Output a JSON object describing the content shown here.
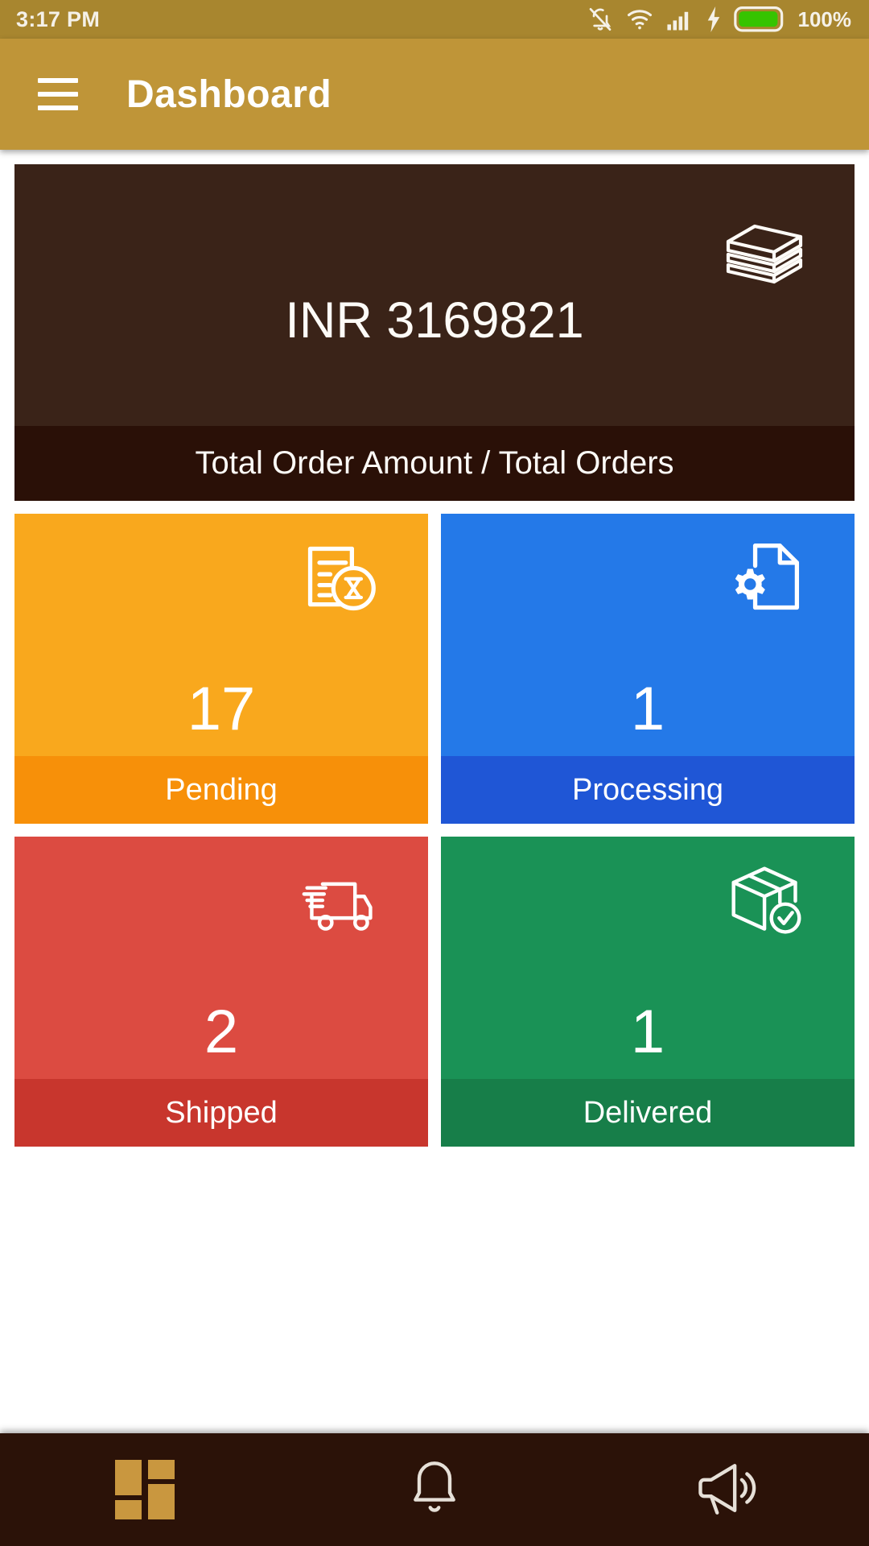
{
  "status_bar": {
    "time": "3:17 PM",
    "battery_percent": "100%",
    "icons": [
      "bell-off-icon",
      "wifi-icon",
      "signal-bars-icon",
      "charging-bolt-icon",
      "battery-icon"
    ]
  },
  "app_bar": {
    "menu_icon": "hamburger-menu-icon",
    "title": "Dashboard"
  },
  "total_card": {
    "icon": "money-stack-icon",
    "value": "INR 3169821",
    "label": "Total Order Amount / Total Orders",
    "bg_color": "#3a2318",
    "label_bg_color": "#2a1007"
  },
  "tiles": [
    {
      "name": "pending",
      "count": "17",
      "label": "Pending",
      "icon": "document-hourglass-icon",
      "color": "#f9a81d",
      "label_color": "#f79009"
    },
    {
      "name": "processing",
      "count": "1",
      "label": "Processing",
      "icon": "document-gear-icon",
      "color": "#2479e8",
      "label_color": "#1f56d6"
    },
    {
      "name": "shipped",
      "count": "2",
      "label": "Shipped",
      "icon": "delivery-truck-icon",
      "color": "#dc4b41",
      "label_color": "#c8362d"
    },
    {
      "name": "delivered",
      "count": "1",
      "label": "Delivered",
      "icon": "box-check-icon",
      "color": "#1a9256",
      "label_color": "#177e49"
    }
  ],
  "bottom_nav": {
    "items": [
      {
        "name": "dashboard",
        "icon": "dashboard-grid-icon",
        "active": true
      },
      {
        "name": "notifications",
        "icon": "bell-icon",
        "active": false
      },
      {
        "name": "announcements",
        "icon": "megaphone-icon",
        "active": false
      }
    ],
    "bg_color": "#2b1208",
    "active_color": "#c9973f"
  }
}
